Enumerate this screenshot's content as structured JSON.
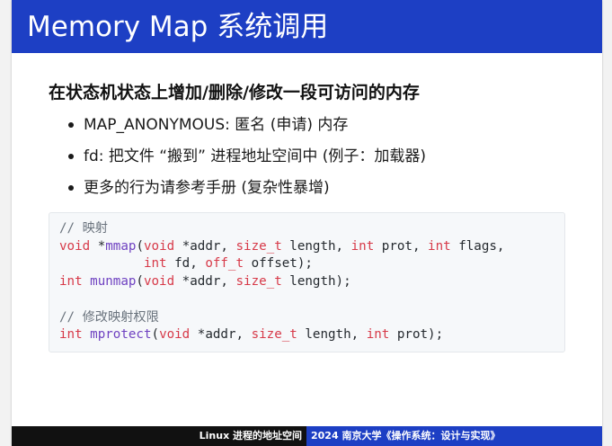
{
  "slide": {
    "title": "Memory Map 系统调用",
    "heading": "在状态机状态上增加/删除/修改一段可访问的内存",
    "bullets": [
      "MAP_ANONYMOUS: 匿名 (申请) 内存",
      "fd: 把文件 “搬到” 进程地址空间中 (例子：加载器)",
      "更多的行为请参考手册 (复杂性暴增)"
    ]
  },
  "code": {
    "lines": [
      [
        {
          "t": "// 映射",
          "k": "comment"
        }
      ],
      [
        {
          "t": "void",
          "k": "keyword"
        },
        {
          "t": " *",
          "k": "plain"
        },
        {
          "t": "mmap",
          "k": "func"
        },
        {
          "t": "(",
          "k": "plain"
        },
        {
          "t": "void",
          "k": "keyword"
        },
        {
          "t": " *addr, ",
          "k": "plain"
        },
        {
          "t": "size_t",
          "k": "keyword"
        },
        {
          "t": " length, ",
          "k": "plain"
        },
        {
          "t": "int",
          "k": "keyword"
        },
        {
          "t": " prot, ",
          "k": "plain"
        },
        {
          "t": "int",
          "k": "keyword"
        },
        {
          "t": " flags,",
          "k": "plain"
        }
      ],
      [
        {
          "t": "           ",
          "k": "plain"
        },
        {
          "t": "int",
          "k": "keyword"
        },
        {
          "t": " fd, ",
          "k": "plain"
        },
        {
          "t": "off_t",
          "k": "keyword"
        },
        {
          "t": " offset);",
          "k": "plain"
        }
      ],
      [
        {
          "t": "int",
          "k": "keyword"
        },
        {
          "t": " ",
          "k": "plain"
        },
        {
          "t": "munmap",
          "k": "func"
        },
        {
          "t": "(",
          "k": "plain"
        },
        {
          "t": "void",
          "k": "keyword"
        },
        {
          "t": " *addr, ",
          "k": "plain"
        },
        {
          "t": "size_t",
          "k": "keyword"
        },
        {
          "t": " length);",
          "k": "plain"
        }
      ],
      [],
      [
        {
          "t": "// 修改映射权限",
          "k": "comment"
        }
      ],
      [
        {
          "t": "int",
          "k": "keyword"
        },
        {
          "t": " ",
          "k": "plain"
        },
        {
          "t": "mprotect",
          "k": "func"
        },
        {
          "t": "(",
          "k": "plain"
        },
        {
          "t": "void",
          "k": "keyword"
        },
        {
          "t": " *addr, ",
          "k": "plain"
        },
        {
          "t": "size_t",
          "k": "keyword"
        },
        {
          "t": " length, ",
          "k": "plain"
        },
        {
          "t": "int",
          "k": "keyword"
        },
        {
          "t": " prot);",
          "k": "plain"
        }
      ]
    ]
  },
  "footer": {
    "left": "Linux 进程的地址空间",
    "right": "2024 南京大学《操作系统：设计与实现》"
  },
  "colors": {
    "accent": "#1d3fc4",
    "footer_dark": "#111111",
    "keyword": "#d73a49",
    "function": "#6f42c1",
    "comment": "#6a737d"
  }
}
